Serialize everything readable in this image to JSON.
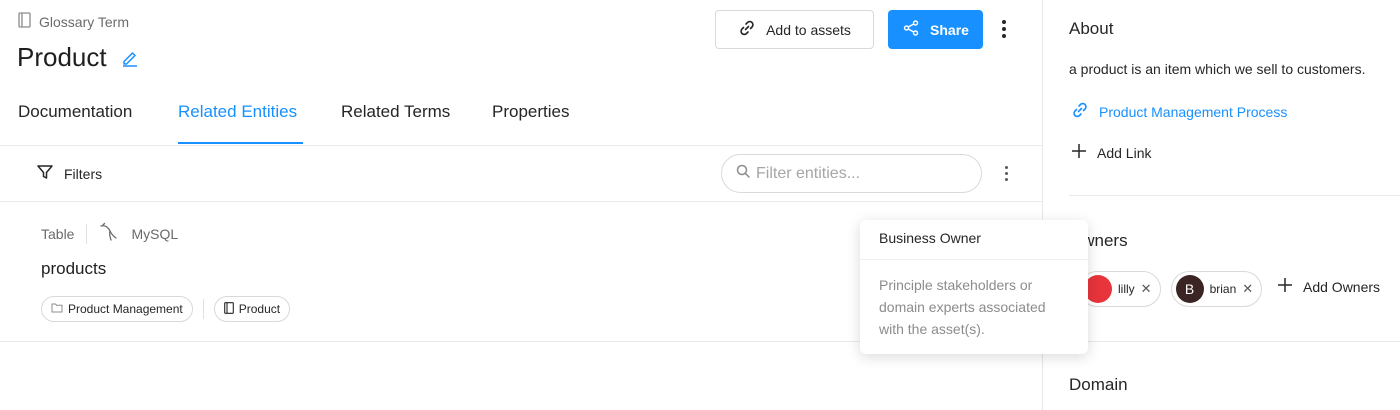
{
  "header": {
    "breadcrumb": "Glossary Term",
    "title": "Product",
    "add_to_assets_label": "Add to assets",
    "share_label": "Share",
    "accent_color": "#1890ff"
  },
  "tabs": [
    {
      "label": "Documentation",
      "active": false
    },
    {
      "label": "Related Entities",
      "active": true
    },
    {
      "label": "Related Terms",
      "active": false
    },
    {
      "label": "Properties",
      "active": false
    }
  ],
  "filter_bar": {
    "filters_label": "Filters",
    "search_placeholder": "Filter entities..."
  },
  "entities": [
    {
      "type": "Table",
      "platform": "MySQL",
      "name": "products",
      "tags": [
        "Product Management",
        "Product"
      ]
    }
  ],
  "tooltip": {
    "title": "Business Owner",
    "body": "Principle stakeholders or domain experts associated with the asset(s)."
  },
  "sidebar": {
    "about": {
      "title": "About",
      "description": "a product is an item which we sell to customers.",
      "link_label": "Product Management Process",
      "add_link_label": "Add Link"
    },
    "owners": {
      "title": "Owners",
      "items": [
        {
          "name": "lilly",
          "avatar_color": "#e8343b"
        },
        {
          "name": "brian",
          "initial": "B",
          "avatar_color": "#3a2424"
        }
      ],
      "add_label": "Add Owners"
    },
    "domain": {
      "title": "Domain"
    }
  }
}
